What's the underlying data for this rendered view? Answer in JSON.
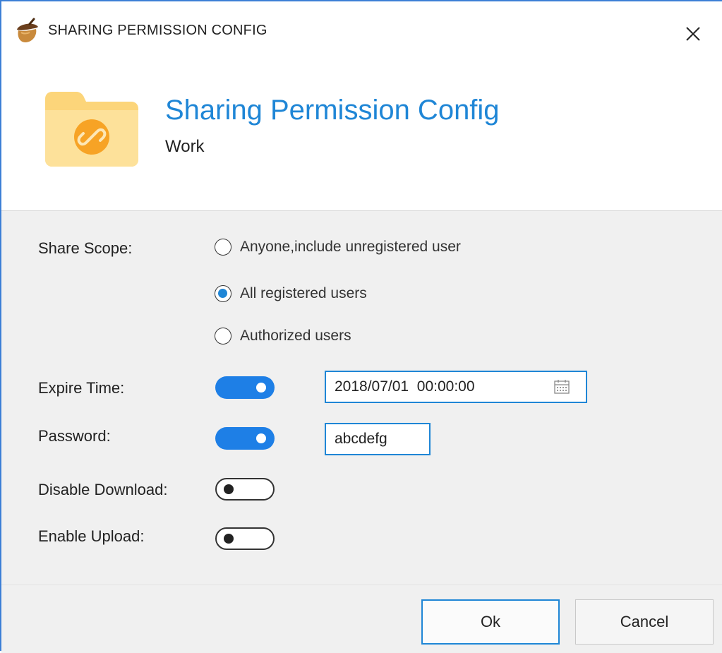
{
  "window": {
    "title": "SHARING PERMISSION CONFIG",
    "app_icon": "acorn-icon",
    "close_icon": "close-icon"
  },
  "header": {
    "title": "Sharing Permission Config",
    "subtitle": "Work",
    "icon": "folder-link-icon"
  },
  "form": {
    "share_scope": {
      "label": "Share Scope:",
      "options": [
        "Anyone,include unregistered user",
        "All registered users",
        "Authorized users"
      ],
      "selected": "All registered users"
    },
    "expire_time": {
      "label": "Expire Time:",
      "enabled": true,
      "value": "2018/07/01  00:00:00",
      "icon": "calendar-icon"
    },
    "password": {
      "label": "Password:",
      "enabled": true,
      "value": "abcdefg"
    },
    "disable_download": {
      "label": "Disable Download:",
      "enabled": false
    },
    "enable_upload": {
      "label": "Enable Upload:",
      "enabled": false
    }
  },
  "buttons": {
    "ok": "Ok",
    "cancel": "Cancel"
  },
  "colors": {
    "accent": "#1f86d6",
    "toggle_on": "#1e7fe6",
    "folder": "#fcdc85",
    "folder_badge": "#f7a325",
    "window_border": "#3c7fd6"
  }
}
